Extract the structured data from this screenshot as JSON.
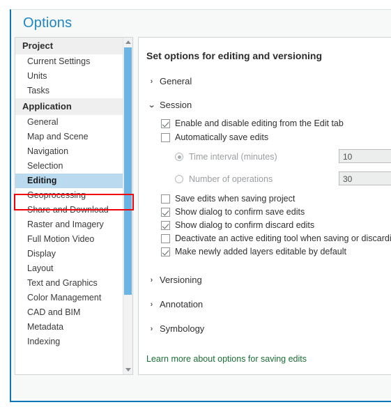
{
  "dialog": {
    "title": "Options"
  },
  "nav": {
    "groups": [
      {
        "header": "Project",
        "items": [
          {
            "label": "Current Settings",
            "selected": false
          },
          {
            "label": "Units",
            "selected": false
          },
          {
            "label": "Tasks",
            "selected": false
          }
        ]
      },
      {
        "header": "Application",
        "items": [
          {
            "label": "General",
            "selected": false
          },
          {
            "label": "Map and Scene",
            "selected": false
          },
          {
            "label": "Navigation",
            "selected": false
          },
          {
            "label": "Selection",
            "selected": false
          },
          {
            "label": "Editing",
            "selected": true
          },
          {
            "label": "Geoprocessing",
            "selected": false
          },
          {
            "label": "Share and Download",
            "selected": false
          },
          {
            "label": "Raster and Imagery",
            "selected": false
          },
          {
            "label": "Full Motion Video",
            "selected": false
          },
          {
            "label": "Display",
            "selected": false
          },
          {
            "label": "Layout",
            "selected": false
          },
          {
            "label": "Text and Graphics",
            "selected": false
          },
          {
            "label": "Color Management",
            "selected": false
          },
          {
            "label": "CAD and BIM",
            "selected": false
          },
          {
            "label": "Metadata",
            "selected": false
          },
          {
            "label": "Indexing",
            "selected": false
          }
        ]
      }
    ],
    "scrollbar": {
      "up_arrow_icon": "triangle-up-icon",
      "down_arrow_icon": "triangle-down-icon"
    },
    "annotation_color": "#f2000a",
    "selection_color": "#badaf0"
  },
  "content": {
    "heading": "Set options for editing and versioning",
    "sections": [
      {
        "label": "General",
        "expanded": false,
        "chevron": "›"
      },
      {
        "label": "Session",
        "expanded": true,
        "chevron": "⌄"
      },
      {
        "label": "Versioning",
        "expanded": false,
        "chevron": "›"
      },
      {
        "label": "Annotation",
        "expanded": false,
        "chevron": "›"
      },
      {
        "label": "Symbology",
        "expanded": false,
        "chevron": "›"
      }
    ],
    "session": {
      "checkboxes_top": [
        {
          "label": "Enable and disable editing from the Edit tab",
          "checked": true
        },
        {
          "label": "Automatically save edits",
          "checked": false
        }
      ],
      "radios": [
        {
          "label": "Time interval (minutes)",
          "selected": true,
          "disabled": true,
          "value": "10"
        },
        {
          "label": "Number of operations",
          "selected": false,
          "disabled": true,
          "value": "30"
        }
      ],
      "checkboxes_bottom": [
        {
          "label": "Save edits when saving project",
          "checked": false
        },
        {
          "label": "Show dialog to confirm save edits",
          "checked": true
        },
        {
          "label": "Show dialog to confirm discard edits",
          "checked": true
        },
        {
          "label": "Deactivate an active editing tool when saving or discarding",
          "checked": false
        },
        {
          "label": "Make newly added layers editable by default",
          "checked": true
        }
      ]
    },
    "learn_more": "Learn more about options for saving edits",
    "link_color": "#1a6f35"
  }
}
